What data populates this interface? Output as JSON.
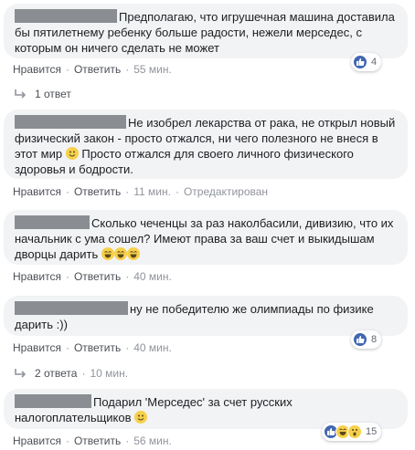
{
  "comments": [
    {
      "text": "Предполагаю, что игрушечная машина доставила бы пятилетнему ребенку больше радости, нежели мерседес, с которым он ничего сделать не может",
      "like_label": "Нравится",
      "reply_label": "Ответить",
      "time": "55 мин.",
      "reactions_count": "4",
      "replies_label": "1 ответ"
    },
    {
      "text_part1": "Не изобрел лекарства от рака, не открыл новый физический закон - просто отжался, ни чего полезного не внеся в этот мир",
      "text_part2": "Просто отжался для своего личного физического здоровья и бодрости.",
      "like_label": "Нравится",
      "reply_label": "Ответить",
      "time": "11 мин.",
      "edited_label": "Отредактирован"
    },
    {
      "text": "Сколько чеченцы за раз наколбасили, дивизию, что их начальник с ума сошел? Имеют права за ваш счет и выкидышам дворцы дарить",
      "like_label": "Нравится",
      "reply_label": "Ответить",
      "time": "40 мин."
    },
    {
      "text": "ну не победителю же олимпиады по физике дарить :))",
      "like_label": "Нравится",
      "reply_label": "Ответить",
      "time": "40 мин.",
      "reactions_count": "8",
      "replies_label": "2 ответа",
      "replies_time": "10 мин."
    },
    {
      "text": "Подарил 'Мерседес' за счет русских налогоплательщиков",
      "like_label": "Нравится",
      "reply_label": "Ответить",
      "time": "56 мин.",
      "reactions_count": "15"
    }
  ],
  "colors": {
    "bubble": "#f2f3f5",
    "link": "#4b4f56",
    "meta": "#90949c",
    "like_blue": "#4267b2",
    "haha_yellow": "#f7d04b"
  },
  "icons": [
    "like-icon",
    "haha-icon",
    "wow-icon",
    "smile-emoji-icon",
    "laugh-emoji-icon",
    "reply-arrow-icon"
  ]
}
